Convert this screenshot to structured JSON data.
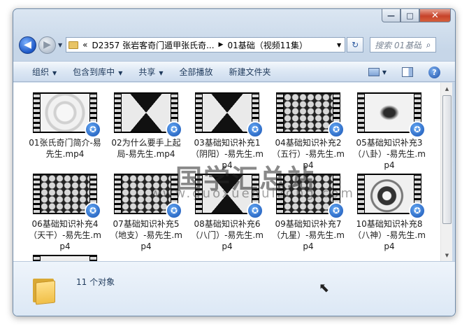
{
  "window": {
    "caption_buttons": [
      "—",
      "□",
      "✕"
    ]
  },
  "nav": {
    "back_label": "◀",
    "forward_label": "▶",
    "drop_label": "▼",
    "address": {
      "prefix": "«",
      "parts": [
        "D2357 张岩客奇门遁甲张氏奇...",
        "01基础（视频11集）"
      ],
      "separator": "▶"
    },
    "refresh_label": "↻",
    "search": {
      "placeholder": "搜索 01基础..."
    }
  },
  "toolbar": {
    "organize": "组织",
    "include_library": "包含到库中",
    "share": "共享",
    "play_all": "全部播放",
    "new_folder": "新建文件夹",
    "help": "?"
  },
  "files": [
    {
      "name": "01张氏奇门简介-易先生.mp4",
      "frame": "swirl"
    },
    {
      "name": "02为什么要手上起局-易先生.mp4",
      "frame": "hourglass"
    },
    {
      "name": "03基础知识补充1（阴阳）-易先生.mp4",
      "frame": "hourglass"
    },
    {
      "name": "04基础知识补充2（五行）-易先生.mp4",
      "frame": "rocks"
    },
    {
      "name": "05基础知识补充3（八卦）-易先生.mp4",
      "frame": "ink"
    },
    {
      "name": "06基础知识补充4（天干）-易先生.mp4",
      "frame": "rocks"
    },
    {
      "name": "07基础知识补充5（地支）-易先生.mp4",
      "frame": "rocks"
    },
    {
      "name": "08基础知识补充6（八门）-易先生.mp4",
      "frame": "hourglass"
    },
    {
      "name": "09基础知识补充7（九星）-易先生.mp4",
      "frame": "rocks"
    },
    {
      "name": "10基础知识补充8（八神）-易先生.mp4",
      "frame": "yinyang"
    },
    {
      "name": "",
      "frame": "pale"
    }
  ],
  "file_labels": [
    "01张氏奇门简介-易先生.mp4",
    "02为什么要手上起局-易先生.mp4",
    "03基础知识补充1（阴阳）-易先生.mp4",
    "04基础知识补充2（五行）-易先生.mp4",
    "05基础知识补充3（八卦）-易先生.mp4",
    "06基础知识补充4（天干）-易先生.mp4",
    "07基础知识补充5（地支）-易先生.mp4",
    "08基础知识补充6（八门）-易先生.mp4",
    "09基础知识补充7（九星）-易先生.mp4",
    "10基础知识补充8（八神）-易先生.mp4"
  ],
  "watermark": {
    "title": "国学汇总站",
    "url": "www.guoxuehuizong.com"
  },
  "details": {
    "count": "11 个对象"
  }
}
